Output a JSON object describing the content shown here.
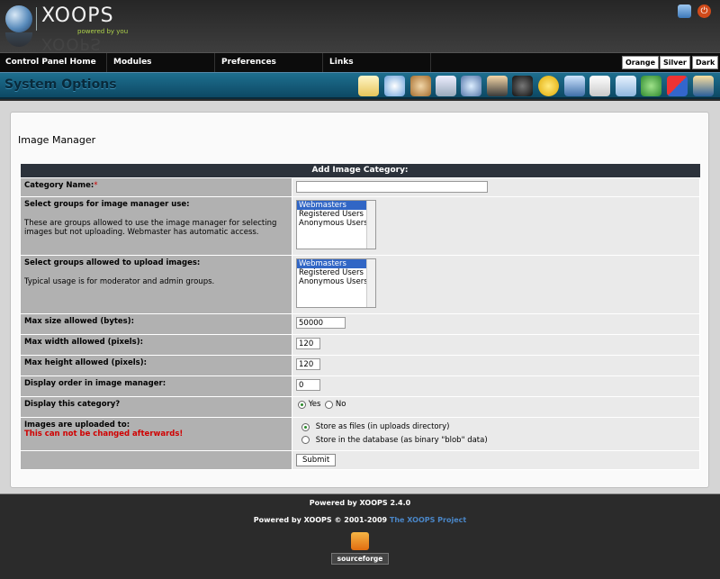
{
  "header": {
    "logo_text": "XOOPS",
    "logo_tagline": "powered by you",
    "home_icon": "home-icon",
    "logout_icon": "power-icon"
  },
  "nav": {
    "items": [
      "Control Panel Home",
      "Modules",
      "Preferences",
      "Links"
    ],
    "themes": [
      "Orange",
      "Silver",
      "Dark"
    ]
  },
  "sysbar": {
    "title": "System Options",
    "tool_icons": [
      "blocks-icon",
      "banners-icon",
      "avatars-icon",
      "comments-icon",
      "find-users-icon",
      "groups-icon",
      "ranks-icon",
      "smilies-icon",
      "images-icon",
      "modules-icon",
      "mail-users-icon",
      "edit-users-icon",
      "preferences-icon",
      "templates-icon"
    ]
  },
  "page": {
    "title": "Image Manager",
    "form_title": "Add Image Category:"
  },
  "form": {
    "category_name_label": "Category Name:",
    "required_mark": "*",
    "category_name_value": "",
    "groups_use_label": "Select groups for image manager use:",
    "groups_use_desc": "These are groups allowed to use the image manager for selecting images but not uploading. Webmaster has automatic access.",
    "groups_use_options": [
      "Webmasters",
      "Registered Users",
      "Anonymous Users"
    ],
    "groups_use_selected": "Webmasters",
    "groups_upload_label": "Select groups allowed to upload images:",
    "groups_upload_desc": "Typical usage is for moderator and admin groups.",
    "groups_upload_options": [
      "Webmasters",
      "Registered Users",
      "Anonymous Users"
    ],
    "groups_upload_selected": "Webmasters",
    "max_size_label": "Max size allowed (bytes):",
    "max_size_value": "50000",
    "max_width_label": "Max width allowed (pixels):",
    "max_width_value": "120",
    "max_height_label": "Max height allowed (pixels):",
    "max_height_value": "120",
    "display_order_label": "Display order in image manager:",
    "display_order_value": "0",
    "display_label": "Display this category?",
    "display_yes": "Yes",
    "display_no": "No",
    "display_selected": "Yes",
    "upload_label": "Images are uploaded to:",
    "upload_warning": "This can not be changed afterwards!",
    "upload_opt_files": "Store as files (in uploads directory)",
    "upload_opt_db": "Store in the database (as binary \"blob\" data)",
    "upload_selected": "files",
    "submit_label": "Submit"
  },
  "footer": {
    "powered": "Powered by XOOPS 2.4.0",
    "copyright": "Powered by XOOPS © 2001-2009",
    "project_link": "The XOOPS Project",
    "badge": "sourceforge"
  }
}
